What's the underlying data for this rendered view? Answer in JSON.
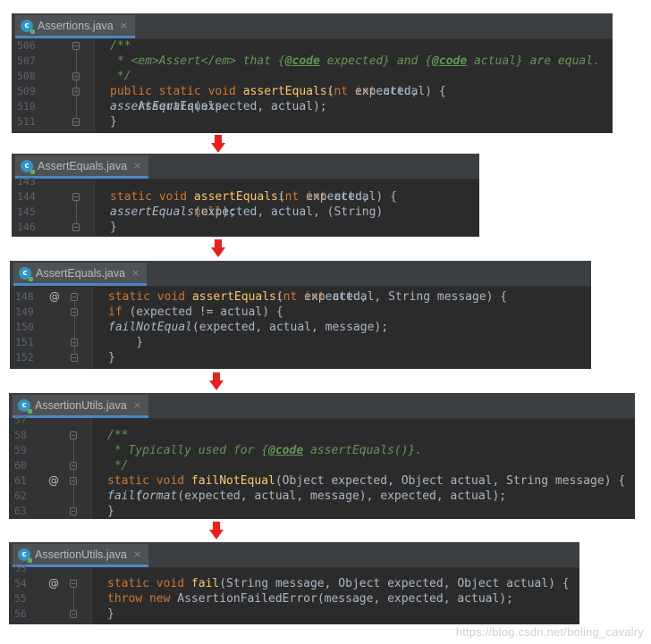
{
  "panels": [
    {
      "tab": {
        "label": "Assertions.java",
        "close": "×"
      },
      "lines": [
        {
          "num": "506",
          "marker": "",
          "fold": true,
          "parts": [
            [
              "doc",
              "/**"
            ]
          ]
        },
        {
          "num": "507",
          "marker": "",
          "fold": false,
          "parts": [
            [
              "doc",
              " * <em>Assert</em> that {"
            ],
            [
              "tag",
              "@code"
            ],
            [
              "doc",
              " expected} and {"
            ],
            [
              "tag",
              "@code"
            ],
            [
              "doc",
              " actual} are equal."
            ]
          ]
        },
        {
          "num": "508",
          "marker": "",
          "fold": true,
          "parts": [
            [
              "doc",
              " */"
            ]
          ]
        },
        {
          "num": "509",
          "marker": "",
          "fold": true,
          "parts": [
            [
              "kw",
              "public static void "
            ],
            [
              "fn",
              "assertEquals"
            ],
            [
              "src",
              "("
            ],
            [
              "kw",
              "int "
            ],
            [
              "src",
              "expected, "
            ],
            [
              "kw",
              "int "
            ],
            [
              "src",
              "actual) {"
            ]
          ]
        },
        {
          "num": "510",
          "marker": "",
          "fold": false,
          "parts": [
            [
              "src",
              "    AssertEquals."
            ],
            [
              "it",
              "assertEquals"
            ],
            [
              "src",
              "(expected, actual);"
            ]
          ]
        },
        {
          "num": "511",
          "marker": "",
          "fold": true,
          "parts": [
            [
              "src",
              "}"
            ]
          ]
        }
      ]
    },
    {
      "tab": {
        "label": "AssertEquals.java",
        "close": "×"
      },
      "lines": [
        {
          "num": "143",
          "marker": "",
          "fold": false,
          "parts": []
        },
        {
          "num": "144",
          "marker": "",
          "fold": true,
          "parts": [
            [
              "kw",
              "static void "
            ],
            [
              "fn",
              "assertEquals"
            ],
            [
              "src",
              "("
            ],
            [
              "kw",
              "int "
            ],
            [
              "src",
              "expected, "
            ],
            [
              "kw",
              "int "
            ],
            [
              "src",
              "actual) {"
            ]
          ]
        },
        {
          "num": "145",
          "marker": "",
          "fold": false,
          "parts": [
            [
              "src",
              "    "
            ],
            [
              "it",
              "assertEquals"
            ],
            [
              "src",
              "(expected, actual, (String) "
            ],
            [
              "kw",
              "null"
            ],
            [
              "src",
              ");"
            ]
          ]
        },
        {
          "num": "146",
          "marker": "",
          "fold": true,
          "parts": [
            [
              "src",
              "}"
            ]
          ]
        }
      ]
    },
    {
      "tab": {
        "label": "AssertEquals.java",
        "close": "×"
      },
      "lines": [
        {
          "num": "148",
          "marker": "@",
          "fold": true,
          "parts": [
            [
              "kw",
              "static void "
            ],
            [
              "fn",
              "assertEquals"
            ],
            [
              "src",
              "("
            ],
            [
              "kw",
              "int "
            ],
            [
              "src",
              "expected, "
            ],
            [
              "kw",
              "int "
            ],
            [
              "src",
              "actual, String message) {"
            ]
          ]
        },
        {
          "num": "149",
          "marker": "",
          "fold": true,
          "parts": [
            [
              "src",
              "    "
            ],
            [
              "kw",
              "if "
            ],
            [
              "src",
              "(expected != actual) {"
            ]
          ]
        },
        {
          "num": "150",
          "marker": "",
          "fold": false,
          "parts": [
            [
              "src",
              "        "
            ],
            [
              "it",
              "failNotEqual"
            ],
            [
              "src",
              "(expected, actual, message);"
            ]
          ]
        },
        {
          "num": "151",
          "marker": "",
          "fold": true,
          "parts": [
            [
              "src",
              "    }"
            ]
          ]
        },
        {
          "num": "152",
          "marker": "",
          "fold": true,
          "parts": [
            [
              "src",
              "}"
            ]
          ]
        }
      ]
    },
    {
      "tab": {
        "label": "AssertionUtils.java",
        "close": "×"
      },
      "lines": [
        {
          "num": "57",
          "marker": "",
          "fold": false,
          "parts": []
        },
        {
          "num": "58",
          "marker": "",
          "fold": true,
          "parts": [
            [
              "doc",
              "/**"
            ]
          ]
        },
        {
          "num": "59",
          "marker": "",
          "fold": false,
          "parts": [
            [
              "doc",
              " * Typically used for {"
            ],
            [
              "tag",
              "@code"
            ],
            [
              "doc",
              " assertEquals()}."
            ]
          ]
        },
        {
          "num": "60",
          "marker": "",
          "fold": true,
          "parts": [
            [
              "doc",
              " */"
            ]
          ]
        },
        {
          "num": "61",
          "marker": "@",
          "fold": true,
          "parts": [
            [
              "kw",
              "static void "
            ],
            [
              "fn",
              "failNotEqual"
            ],
            [
              "src",
              "(Object expected, Object actual, String message) {"
            ]
          ]
        },
        {
          "num": "62",
          "marker": "",
          "fold": false,
          "parts": [
            [
              "src",
              "    "
            ],
            [
              "it",
              "fail"
            ],
            [
              "src",
              "("
            ],
            [
              "it",
              "format"
            ],
            [
              "src",
              "(expected, actual, message), expected, actual);"
            ]
          ]
        },
        {
          "num": "63",
          "marker": "",
          "fold": true,
          "parts": [
            [
              "src",
              "}"
            ]
          ]
        }
      ]
    },
    {
      "tab": {
        "label": "AssertionUtils.java",
        "close": "×"
      },
      "lines": [
        {
          "num": "53",
          "marker": "",
          "fold": false,
          "parts": []
        },
        {
          "num": "54",
          "marker": "@",
          "fold": true,
          "parts": [
            [
              "kw",
              "static void "
            ],
            [
              "fn",
              "fail"
            ],
            [
              "src",
              "(String message, Object expected, Object actual) {"
            ]
          ]
        },
        {
          "num": "55",
          "marker": "",
          "fold": false,
          "parts": [
            [
              "src",
              "    "
            ],
            [
              "kw",
              "throw new "
            ],
            [
              "src",
              "AssertionFailedError(message, expected, actual);"
            ]
          ]
        },
        {
          "num": "56",
          "marker": "",
          "fold": true,
          "parts": [
            [
              "src",
              "}"
            ]
          ]
        }
      ]
    }
  ],
  "watermark": "https://blog.csdn.net/boling_cavalry",
  "colors": {
    "editor_bg": "#2b2b2b",
    "gutter_bg": "#313335",
    "keyword": "#cc7832",
    "method": "#ffc66d",
    "doc_comment": "#629755",
    "text": "#a9b7c6",
    "arrow": "#e8201c"
  }
}
